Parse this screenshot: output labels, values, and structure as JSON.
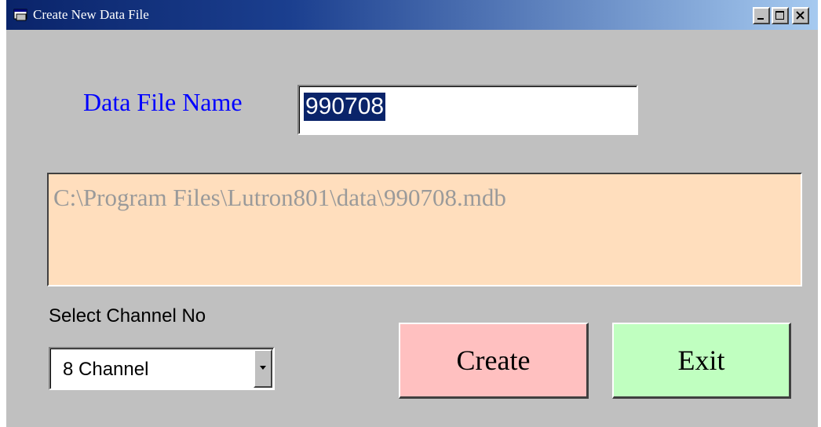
{
  "window": {
    "title": "Create New Data File",
    "title_icon": "app-window-icon",
    "controls": [
      "minimize-icon",
      "maximize-icon",
      "close-icon"
    ]
  },
  "form": {
    "file_name_label": "Data File Name",
    "file_name_value": "990708",
    "file_path": "C:\\Program Files\\Lutron801\\data\\990708.mdb",
    "channel_label": "Select Channel No",
    "channel_value": "8 Channel",
    "channel_dropdown_icon": "chevron-down-icon"
  },
  "buttons": {
    "create": "Create",
    "exit": "Exit"
  },
  "colors": {
    "title_bar_start": "#0a246a",
    "title_bar_end": "#a6caf0",
    "window_bg": "#c0c0c0",
    "label_blue": "#0000ff",
    "path_box_bg": "#ffdebd",
    "path_text": "#9a9a9a",
    "create_button_bg": "#ffc0c0",
    "exit_button_bg": "#c0ffc0",
    "selection_bg": "#0a246a"
  }
}
